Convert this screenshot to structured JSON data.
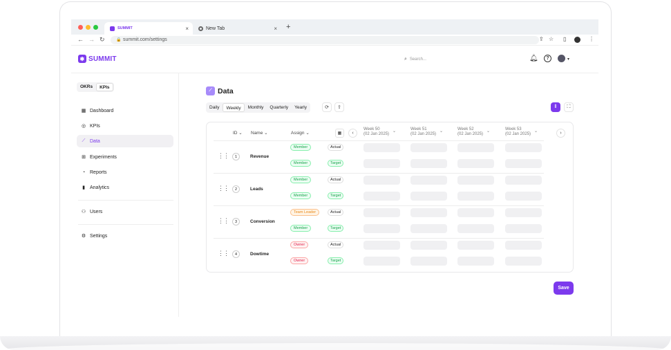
{
  "browser": {
    "tabs": [
      {
        "label": "SUMMIT",
        "active": true
      },
      {
        "label": "New Tab",
        "active": false
      }
    ],
    "url": "summit.com/settings"
  },
  "app": {
    "logo_text": "SUMMIT",
    "search_placeholder": "Search..."
  },
  "sidebar": {
    "toggle": [
      "OKRs",
      "KPIs"
    ],
    "toggle_selected": "KPIs",
    "items": [
      {
        "label": "Dashboard",
        "icon": "grid-icon"
      },
      {
        "label": "KPIs",
        "icon": "target-icon"
      },
      {
        "label": "Data",
        "icon": "chart-icon"
      },
      {
        "label": "Experiments",
        "icon": "flask-icon"
      },
      {
        "label": "Reports",
        "icon": "pie-icon"
      },
      {
        "label": "Analytics",
        "icon": "bar-chart-icon"
      }
    ],
    "users_label": "Users",
    "settings_label": "Settings",
    "active_item": "Data"
  },
  "main": {
    "title": "Data",
    "periods": [
      "Daily",
      "Weekly",
      "Monthly",
      "Quarterly",
      "Yearly"
    ],
    "selected_period": "Weekly",
    "columns": {
      "id": "ID",
      "name": "Name",
      "assign": "Assign"
    },
    "weeks": [
      {
        "label": "Week 50",
        "date": "(02 Jan 2025)"
      },
      {
        "label": "Week 51",
        "date": "(02 Jan 2025)"
      },
      {
        "label": "Week 52",
        "date": "(02 Jan 2025)"
      },
      {
        "label": "Week 53",
        "date": "(02 Jan 2025)"
      }
    ],
    "rows": [
      {
        "id": "1",
        "name": "Revenue",
        "assign": [
          "Member",
          "Member"
        ],
        "types": [
          "Actual",
          "Target"
        ]
      },
      {
        "id": "2",
        "name": "Leads",
        "assign": [
          "Member",
          "Member"
        ],
        "types": [
          "Actual",
          "Target"
        ]
      },
      {
        "id": "3",
        "name": "Conversion",
        "assign": [
          "Team Leader",
          "Member"
        ],
        "types": [
          "Actual",
          "Target"
        ]
      },
      {
        "id": "4",
        "name": "Dowtime",
        "assign": [
          "Owner",
          "Owner"
        ],
        "types": [
          "Actual",
          "Target"
        ]
      }
    ],
    "save_label": "Save",
    "accent": "#7c3aed"
  }
}
